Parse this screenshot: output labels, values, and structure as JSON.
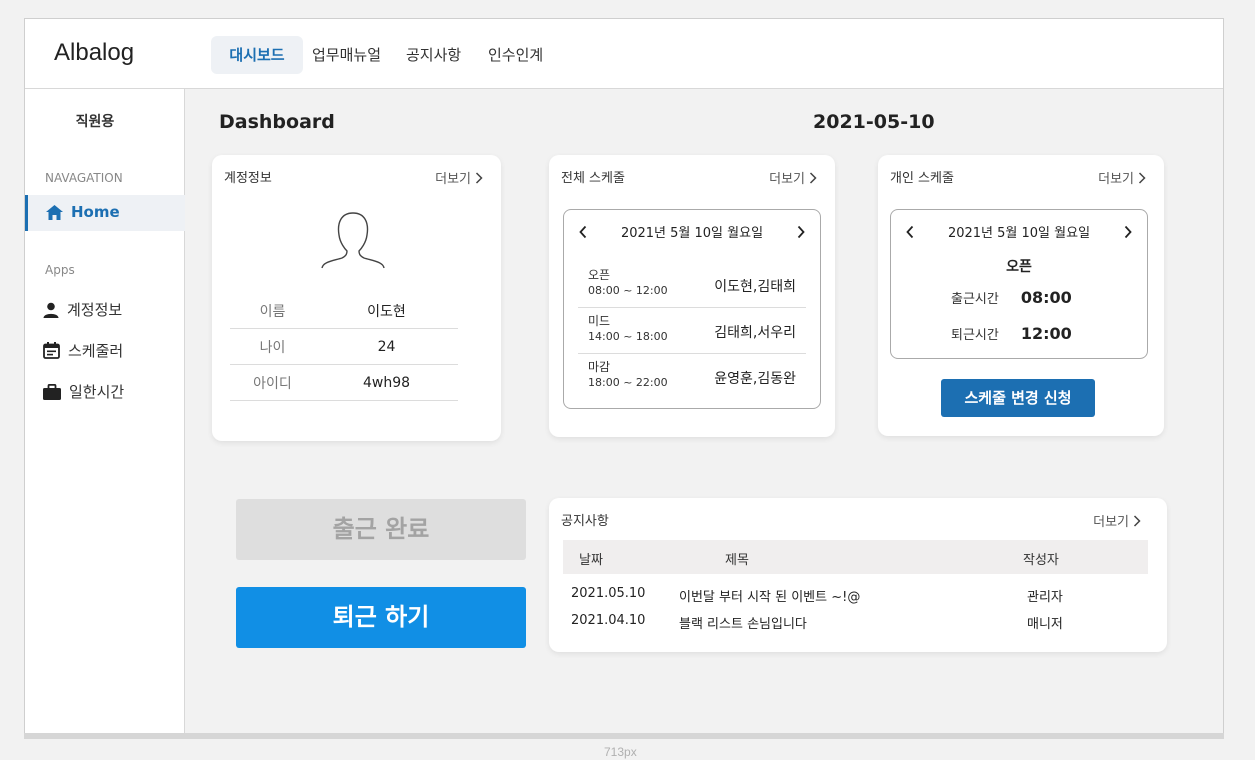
{
  "app": {
    "logo": "Albalog"
  },
  "nav": {
    "tabs": [
      {
        "label": "대시보드",
        "active": true
      },
      {
        "label": "업무매뉴얼"
      },
      {
        "label": "공지사항"
      },
      {
        "label": "인수인계"
      }
    ]
  },
  "sidebar": {
    "title": "직원용",
    "section_nav": "NAVAGATION",
    "home_label": "Home",
    "section_apps": "Apps",
    "items": [
      {
        "label": "계정정보",
        "icon": "person-icon"
      },
      {
        "label": "스케줄러",
        "icon": "calendar-icon"
      },
      {
        "label": "일한시간",
        "icon": "briefcase-icon"
      }
    ]
  },
  "main": {
    "title": "Dashboard",
    "date": "2021-05-10"
  },
  "account": {
    "title": "계정정보",
    "more": "더보기",
    "rows": [
      {
        "key": "이름",
        "value": "이도현"
      },
      {
        "key": "나이",
        "value": "24"
      },
      {
        "key": "아이디",
        "value": "4wh98"
      }
    ]
  },
  "all_schedule": {
    "title": "전체 스케줄",
    "more": "더보기",
    "date_label": "2021년 5월 10일 월요일",
    "shifts": [
      {
        "name": "오픈",
        "time": "08:00 ~ 12:00",
        "staff": "이도현,김태희"
      },
      {
        "name": "미드",
        "time": "14:00 ~ 18:00",
        "staff": "김태희,서우리"
      },
      {
        "name": "마감",
        "time": "18:00 ~ 22:00",
        "staff": "윤영훈,김동완"
      }
    ]
  },
  "personal_schedule": {
    "title": "개인 스케줄",
    "more": "더보기",
    "date_label": "2021년 5월 10일 월요일",
    "shift": "오픈",
    "clock_in_label": "출근시간",
    "clock_in": "08:00",
    "clock_out_label": "퇴근시간",
    "clock_out": "12:00",
    "change_button": "스케줄 변경 신청"
  },
  "actions": {
    "clock_in_done": "출근 완료",
    "clock_out": "퇴근 하기"
  },
  "notices": {
    "title": "공지사항",
    "more": "더보기",
    "columns": [
      "날짜",
      "제목",
      "작성자"
    ],
    "rows": [
      {
        "date": "2021.05.10",
        "subject": "이번달 부터 시작 된 이벤트 ~!@",
        "author": "관리자"
      },
      {
        "date": "2021.04.10",
        "subject": "블랙 리스트 손님입니다",
        "author": "매니저"
      }
    ]
  },
  "canvas_caption": "713px",
  "colors": {
    "accent": "#1c6fb2",
    "primary_button": "#118fe5",
    "disabled_button": "#dedede",
    "background": "#f2f2f2"
  }
}
